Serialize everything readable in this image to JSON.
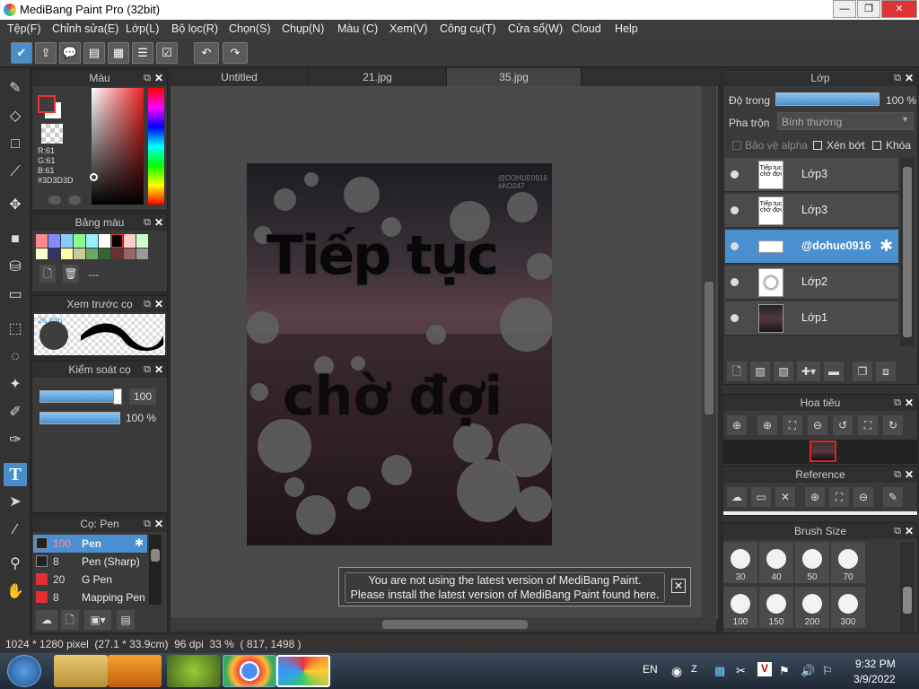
{
  "window": {
    "title": "MediBang Paint Pro (32bit)",
    "min": "—",
    "max": "❐",
    "close": "✕"
  },
  "menu": [
    "Tệp(F)",
    "Chỉnh sửa(E)",
    "Lớp(L)",
    "Bộ lọc(R)",
    "Chọn(S)",
    "Chụp(N)",
    "Màu (C)",
    "Xem(V)",
    "Công cụ(T)",
    "Cửa sổ(W)",
    "Cloud",
    "Help"
  ],
  "color_panel": {
    "title": "Màu",
    "r": "R:61",
    "g": "G:61",
    "b": "B:61",
    "hex": "#3D3D3D"
  },
  "palette_panel": {
    "title": "Bảng màu",
    "dash": "---"
  },
  "preview_panel": {
    "title": "Xem trước cọ",
    "size": "26.46p"
  },
  "brush_control": {
    "title": "Kiểm soát cọ",
    "size": "100",
    "opacity": "100 %"
  },
  "brush_panel": {
    "title": "Cọ: Pen",
    "items": [
      {
        "num": "100",
        "name": "Pen",
        "color": "#222222"
      },
      {
        "num": "8",
        "name": "Pen (Sharp)",
        "color": "#222222"
      },
      {
        "num": "20",
        "name": "G Pen",
        "color": "#e03030"
      },
      {
        "num": "8",
        "name": "Mapping Pen",
        "color": "#e03030"
      }
    ]
  },
  "tabs": [
    "Untitled",
    "21.jpg",
    "35.jpg"
  ],
  "artwork": {
    "line1": "Tiếp tục",
    "line2": "chờ đợi",
    "wm1": "@DOHUE0916",
    "wm2": "#KO247"
  },
  "notice": {
    "line1": "You are not using the latest version of MediBang Paint.",
    "line2": "Please install the latest version of MediBang Paint found here."
  },
  "layer_panel": {
    "title": "Lớp",
    "opacity_label": "Độ trong",
    "opacity_value": "100 %",
    "blend_label": "Pha trộn",
    "blend_value": "Bình thường",
    "alpha_protect": "Bảo vệ alpha",
    "clip": "Xén bớt",
    "lock": "Khóa",
    "layers": [
      "Lớp3",
      "Lớp3",
      "@dohue0916",
      "Lớp2",
      "Lớp1"
    ]
  },
  "navigator": {
    "title": "Hoa tiêu"
  },
  "reference": {
    "title": "Reference"
  },
  "brush_size": {
    "title": "Brush Size",
    "sizes": [
      "30",
      "40",
      "50",
      "70",
      "100",
      "150",
      "200",
      "300"
    ]
  },
  "status": {
    "text": "1024 * 1280 pixel  (27.1 * 33.9cm)  96 dpi  33 %  ( 817, 1498 )"
  },
  "taskbar": {
    "lang": "EN",
    "time": "9:32 PM",
    "date": "3/9/2022"
  },
  "colors": {
    "accent": "#4a90d0",
    "panel": "#3a3a3a"
  }
}
